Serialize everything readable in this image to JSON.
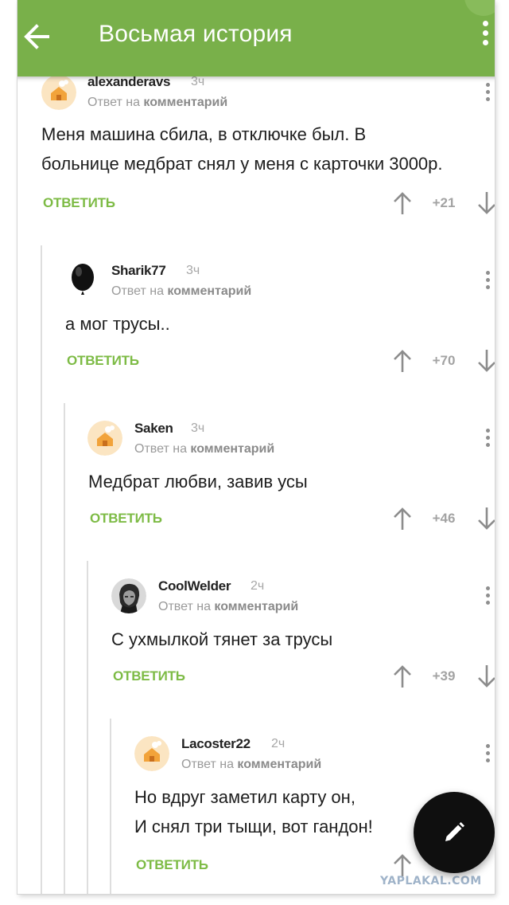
{
  "header": {
    "title": "Восьмая история",
    "back_icon": "arrow-left-icon",
    "menu_icon": "more-vert-icon",
    "color": "#79b04a"
  },
  "comments": [
    {
      "author": "alexanderavs",
      "time": "3ч",
      "reply_prefix": "Ответ на",
      "reply_target": "комментарий",
      "text_lines": [
        "Меня машина сбила, в отключке был. В",
        "больнице медбрат снял у меня с карточки 3000р."
      ],
      "reply_label": "ОТВЕТИТЬ",
      "score": "+21",
      "avatar": "house-avatar"
    },
    {
      "author": "Sharik77",
      "time": "3ч",
      "reply_prefix": "Ответ на",
      "reply_target": "комментарий",
      "text_lines": [
        "а мог трусы.."
      ],
      "reply_label": "ОТВЕТИТЬ",
      "score": "+70",
      "avatar": "balloon-avatar"
    },
    {
      "author": "Saken",
      "time": "3ч",
      "reply_prefix": "Ответ на",
      "reply_target": "комментарий",
      "text_lines": [
        "Медбрат любви, завив усы"
      ],
      "reply_label": "ОТВЕТИТЬ",
      "score": "+46",
      "avatar": "house-avatar"
    },
    {
      "author": "CoolWelder",
      "time": "2ч",
      "reply_prefix": "Ответ на",
      "reply_target": "комментарий",
      "text_lines": [
        "С ухмылкой тянет за трусы"
      ],
      "reply_label": "ОТВЕТИТЬ",
      "score": "+39",
      "avatar": "portrait-avatar"
    },
    {
      "author": "Lacoster22",
      "time": "2ч",
      "reply_prefix": "Ответ на",
      "reply_target": "комментарий",
      "text_lines": [
        "Но вдруг заметил карту он,",
        "И снял три тыщи, вот гандон!"
      ],
      "reply_label": "ОТВЕТИТЬ",
      "score": "",
      "avatar": "house-avatar"
    }
  ],
  "fab": {
    "icon": "pencil-icon"
  },
  "watermark": "YAPLAKAL.COM",
  "colors": {
    "accent": "#7dbb45",
    "fab": "#0f0f0f"
  }
}
